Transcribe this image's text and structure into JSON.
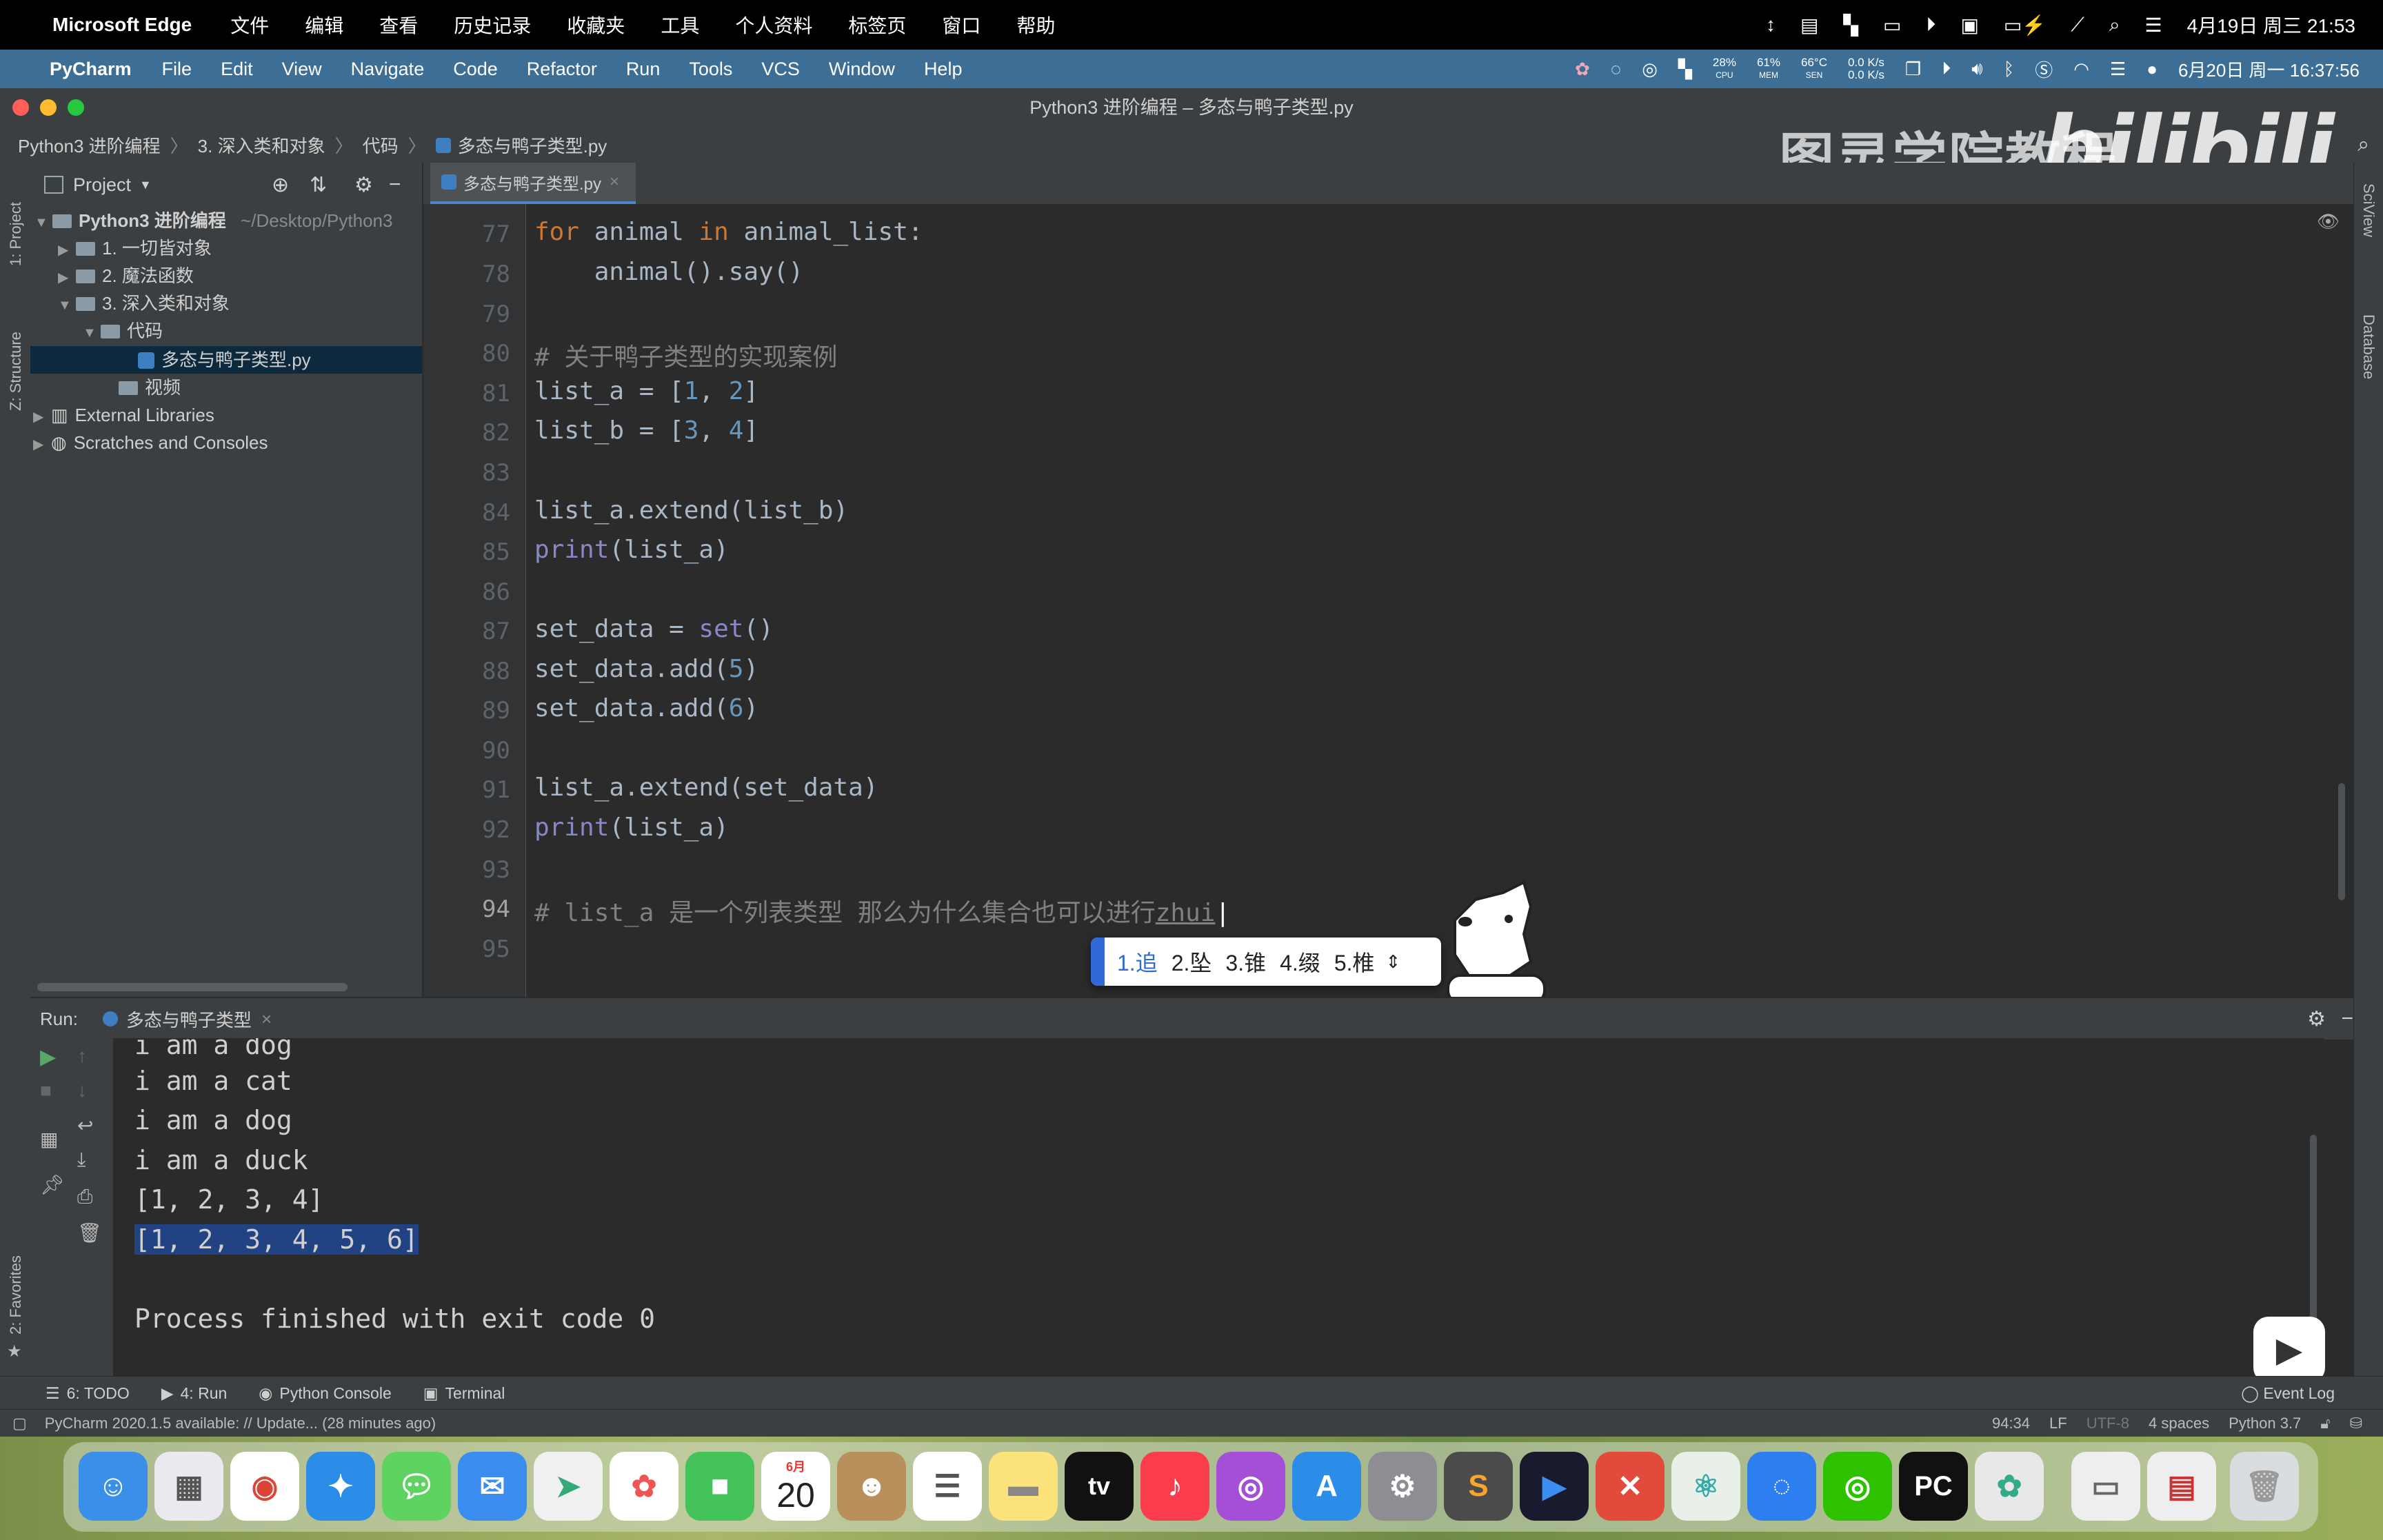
{
  "macbar": {
    "app_name": "Microsoft Edge",
    "menus": [
      "文件",
      "编辑",
      "查看",
      "历史记录",
      "收藏夹",
      "工具",
      "个人资料",
      "标签页",
      "窗口",
      "帮助"
    ],
    "datetime": "4月19日 周三 21:53"
  },
  "pc_menubar": {
    "app_name": "PyCharm",
    "menus": [
      "File",
      "Edit",
      "View",
      "Navigate",
      "Code",
      "Refactor",
      "Run",
      "Tools",
      "VCS",
      "Window",
      "Help"
    ],
    "cpu": "28%",
    "cpu_label": "CPU",
    "mem": "61%",
    "mem_label": "MEM",
    "sen": "66°C",
    "sen_label": "SEN",
    "net_up": "0.0 K/s",
    "net_down": "0.0 K/s",
    "datetime": "6月20日 周一 16:37:56"
  },
  "window": {
    "title": "Python3 进阶编程 – 多态与鸭子类型.py"
  },
  "breadcrumbs": [
    "Python3 进阶编程",
    "3. 深入类和对象",
    "代码",
    "多态与鸭子类型.py"
  ],
  "watermark": {
    "text": "图灵学院教程",
    "logo": "bilibili"
  },
  "left_stripe": {
    "project": "1: Project",
    "structure": "Z: Structure",
    "favorites": "2: Favorites"
  },
  "right_stripe": {
    "sciview": "SciView",
    "database": "Database"
  },
  "project_panel": {
    "header": "Project",
    "root_name": "Python3 进阶编程",
    "root_path": "~/Desktop/Python3",
    "items": [
      {
        "label": "1. 一切皆对象"
      },
      {
        "label": "2. 魔法函数"
      },
      {
        "label": "3. 深入类和对象"
      },
      {
        "label": "代码"
      },
      {
        "label": "多态与鸭子类型.py"
      },
      {
        "label": "视频"
      },
      {
        "label": "External Libraries"
      },
      {
        "label": "Scratches and Consoles"
      }
    ]
  },
  "editor": {
    "tab_label": "多态与鸭子类型.py",
    "line_numbers": [
      "77",
      "78",
      "79",
      "80",
      "81",
      "82",
      "83",
      "84",
      "85",
      "86",
      "87",
      "88",
      "89",
      "90",
      "91",
      "92",
      "93",
      "94",
      "95"
    ],
    "comment_80": "# 关于鸭子类型的实现案例",
    "comment_94": "# list_a 是一个列表类型 那么为什么集合也可以进行",
    "typing": "zhui"
  },
  "ime": {
    "candidates": [
      "1.追",
      "2.坠",
      "3.锥",
      "4.缀",
      "5.椎"
    ]
  },
  "run": {
    "label": "Run:",
    "tab_label": "多态与鸭子类型",
    "output": [
      "i am a dog",
      "i am a cat",
      "i am a dog",
      "i am a duck",
      "[1, 2, 3, 4]",
      "[1, 2, 3, 4, 5, 6]",
      "",
      "Process finished with exit code 0"
    ]
  },
  "tool_windows": [
    "6: TODO",
    "4: Run",
    "Python Console",
    "Terminal"
  ],
  "event_log": "Event Log",
  "status": {
    "message": "PyCharm 2020.1.5 available: // Update... (28 minutes ago)",
    "position": "94:34",
    "line_sep": "LF",
    "encoding": "UTF-8",
    "indent": "4 spaces",
    "interpreter": "Python 3.7"
  },
  "dock": {
    "calendar_month": "6月",
    "calendar_day": "20",
    "tv_label": "tv",
    "pycharm_label": "PC"
  }
}
